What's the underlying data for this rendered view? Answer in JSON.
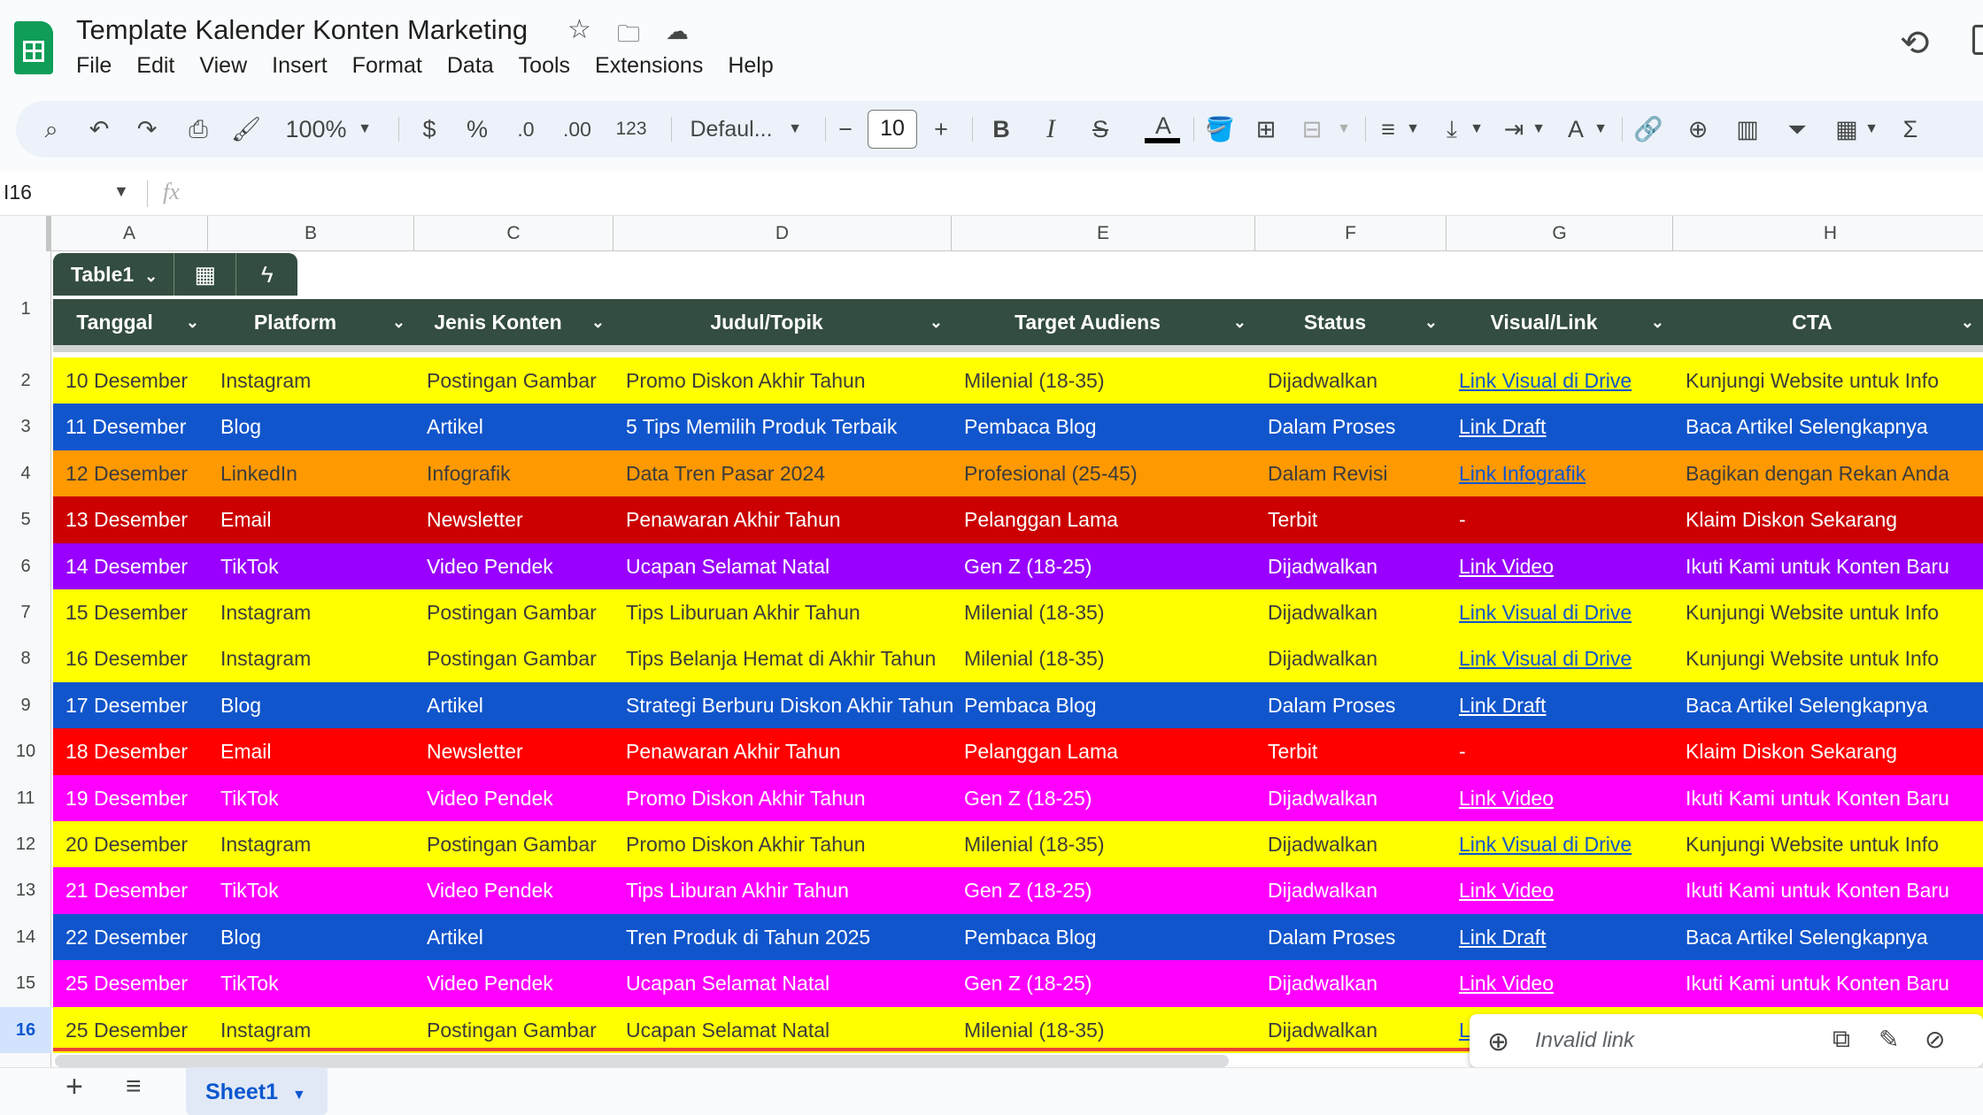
{
  "header": {
    "doc_title": "Template Kalender Konten Marketing",
    "menu": [
      "File",
      "Edit",
      "View",
      "Insert",
      "Format",
      "Data",
      "Tools",
      "Extensions",
      "Help"
    ]
  },
  "toolbar": {
    "zoom": "100%",
    "currency": "$",
    "percent": "%",
    "dec_decrease": ".0",
    "dec_increase": ".00",
    "number_format": "123",
    "font": "Defaul...",
    "font_size": "10",
    "bold": "B",
    "italic": "I",
    "strike": "S",
    "text_color": "A",
    "text_rotate": "A"
  },
  "formula_bar": {
    "cell_ref": "I16",
    "fx": "fx",
    "value": ""
  },
  "columns": [
    "A",
    "B",
    "C",
    "D",
    "E",
    "F",
    "G",
    "H"
  ],
  "table": {
    "name": "Table1",
    "headers": [
      "Tanggal",
      "Platform",
      "Jenis Konten",
      "Judul/Topik",
      "Target Audiens",
      "Status",
      "Visual/Link",
      "CTA"
    ],
    "rows": [
      {
        "num": "2",
        "bg": "#ffff00",
        "fg": "#3c3c3c",
        "link": "#1155cc",
        "cells": [
          "10 Desember",
          "Instagram",
          "Postingan Gambar",
          "Promo Diskon Akhir Tahun",
          "Milenial (18-35)",
          "Dijadwalkan",
          "Link Visual di Drive",
          "Kunjungi Website untuk Info"
        ]
      },
      {
        "num": "3",
        "bg": "#1155cc",
        "fg": "#ffffff",
        "link": "#ffffff",
        "cells": [
          "11 Desember",
          "Blog",
          "Artikel",
          "5 Tips Memilih Produk Terbaik",
          "Pembaca Blog",
          "Dalam Proses",
          "Link Draft",
          "Baca Artikel Selengkapnya"
        ]
      },
      {
        "num": "4",
        "bg": "#ff9900",
        "fg": "#3c3c3c",
        "link": "#1155cc",
        "cells": [
          "12 Desember",
          "LinkedIn",
          "Infografik",
          "Data Tren Pasar 2024",
          "Profesional (25-45)",
          "Dalam Revisi",
          "Link Infografik",
          "Bagikan dengan Rekan Anda"
        ]
      },
      {
        "num": "5",
        "bg": "#cc0000",
        "fg": "#ffffff",
        "link": "#ffffff",
        "cells": [
          "13 Desember",
          "Email",
          "Newsletter",
          "Penawaran Akhir Tahun",
          "Pelanggan Lama",
          "Terbit",
          "-",
          "Klaim Diskon Sekarang"
        ]
      },
      {
        "num": "6",
        "bg": "#9900ff",
        "fg": "#ffffff",
        "link": "#ffffff",
        "cells": [
          "14 Desember",
          "TikTok",
          "Video Pendek",
          "Ucapan Selamat Natal",
          "Gen Z (18-25)",
          "Dijadwalkan",
          "Link Video",
          "Ikuti Kami untuk Konten Baru"
        ]
      },
      {
        "num": "7",
        "bg": "#ffff00",
        "fg": "#3c3c3c",
        "link": "#1155cc",
        "cells": [
          "15 Desember",
          "Instagram",
          "Postingan Gambar",
          "Tips Liburuan Akhir Tahun",
          "Milenial (18-35)",
          "Dijadwalkan",
          "Link Visual di Drive",
          "Kunjungi Website untuk Info"
        ]
      },
      {
        "num": "8",
        "bg": "#ffff00",
        "fg": "#3c3c3c",
        "link": "#1155cc",
        "cells": [
          "16 Desember",
          "Instagram",
          "Postingan Gambar",
          "Tips Belanja Hemat di Akhir Tahun",
          "Milenial (18-35)",
          "Dijadwalkan",
          "Link Visual di Drive",
          "Kunjungi Website untuk Info"
        ]
      },
      {
        "num": "9",
        "bg": "#1155cc",
        "fg": "#ffffff",
        "link": "#ffffff",
        "cells": [
          "17 Desember",
          "Blog",
          "Artikel",
          "Strategi Berburu Diskon Akhir Tahun",
          "Pembaca Blog",
          "Dalam Proses",
          "Link Draft",
          "Baca Artikel Selengkapnya"
        ]
      },
      {
        "num": "10",
        "bg": "#ff0000",
        "fg": "#ffffff",
        "link": "#ffffff",
        "cells": [
          "18 Desember",
          "Email",
          "Newsletter",
          "Penawaran Akhir Tahun",
          "Pelanggan Lama",
          "Terbit",
          "-",
          "Klaim Diskon Sekarang"
        ]
      },
      {
        "num": "11",
        "bg": "#ff00ff",
        "fg": "#ffffff",
        "link": "#ffffff",
        "cells": [
          "19 Desember",
          "TikTok",
          "Video Pendek",
          "Promo Diskon Akhir Tahun",
          "Gen Z (18-25)",
          "Dijadwalkan",
          "Link Video",
          "Ikuti Kami untuk Konten Baru"
        ]
      },
      {
        "num": "12",
        "bg": "#ffff00",
        "fg": "#3c3c3c",
        "link": "#1155cc",
        "cells": [
          "20 Desember",
          "Instagram",
          "Postingan Gambar",
          "Promo Diskon Akhir Tahun",
          "Milenial (18-35)",
          "Dijadwalkan",
          "Link Visual di Drive",
          "Kunjungi Website untuk Info"
        ]
      },
      {
        "num": "13",
        "bg": "#ff00ff",
        "fg": "#ffffff",
        "link": "#ffffff",
        "cells": [
          "21 Desember",
          "TikTok",
          "Video Pendek",
          "Tips Liburan Akhir Tahun",
          "Gen Z (18-25)",
          "Dijadwalkan",
          "Link Video",
          "Ikuti Kami untuk Konten Baru"
        ]
      },
      {
        "num": "14",
        "bg": "#1155cc",
        "fg": "#ffffff",
        "link": "#ffffff",
        "cells": [
          "22 Desember",
          "Blog",
          "Artikel",
          "Tren Produk di Tahun 2025",
          "Pembaca Blog",
          "Dalam Proses",
          "Link Draft",
          "Baca Artikel Selengkapnya"
        ]
      },
      {
        "num": "15",
        "bg": "#ff00ff",
        "fg": "#ffffff",
        "link": "#ffffff",
        "cells": [
          "25 Desember",
          "TikTok",
          "Video Pendek",
          "Ucapan Selamat Natal",
          "Gen Z (18-25)",
          "Dijadwalkan",
          "Link Video",
          "Ikuti Kami untuk Konten Baru"
        ]
      },
      {
        "num": "16",
        "bg": "#ffff00",
        "fg": "#3c3c3c",
        "link": "#1155cc",
        "cells": [
          "25 Desember",
          "Instagram",
          "Postingan Gambar",
          "Ucapan Selamat Natal",
          "Milenial (18-35)",
          "Dijadwalkan",
          "L",
          ""
        ]
      }
    ]
  },
  "link_popup": {
    "text": "Invalid link"
  },
  "sheet_tabs": {
    "active": "Sheet1"
  },
  "colors": {
    "table_header": "#334d40",
    "selection": "#0b57d0",
    "accent_green": "#0f9d58"
  }
}
